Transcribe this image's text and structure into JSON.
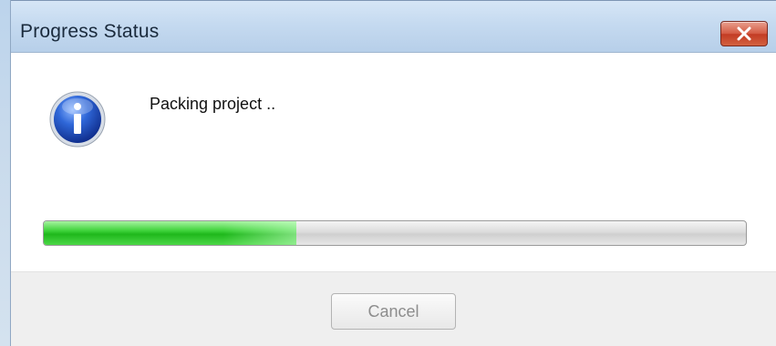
{
  "window": {
    "title": "Progress Status"
  },
  "dialog": {
    "message": "Packing project ..",
    "icon": "info-icon",
    "progress_percent": 36,
    "cancel_label": "Cancel",
    "cancel_enabled": false
  },
  "colors": {
    "progress_fill": "#2fc72b",
    "close_button": "#d24e34",
    "title_bar": "#c5daf0"
  }
}
